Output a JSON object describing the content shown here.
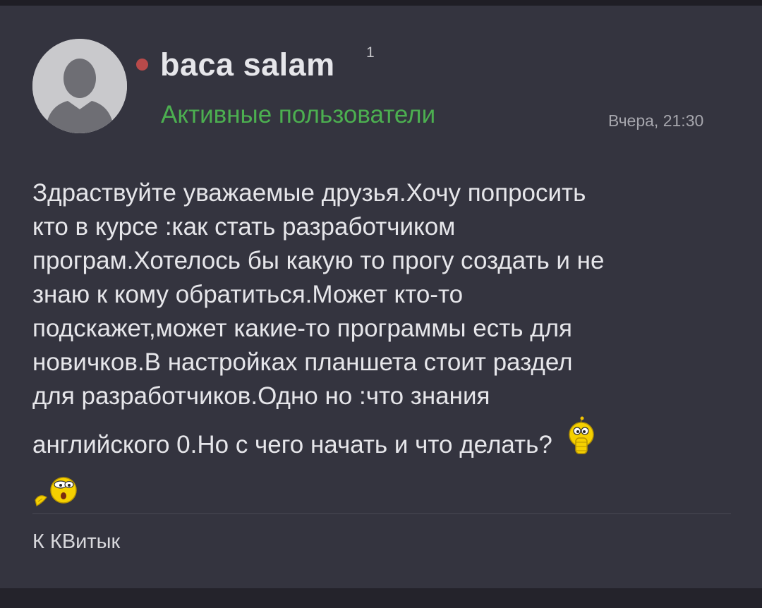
{
  "post": {
    "author": {
      "name": "baca salam",
      "badge_count": "1",
      "group": "Активные пользователи",
      "status_color": "#b84a4a",
      "avatar_icon": "default-user-silhouette-icon"
    },
    "timestamp": "Вчера, 21:30",
    "body_lines": [
      "Здраствуйте уважаемые друзья.Хочу попросить",
      "кто в курсе :как стать разработчиком",
      "програм.Хотелось бы какую то прогу создать и не",
      "знаю к кому обратиться.Может кто-то",
      "подскажет,может какие-то программы есть для",
      "новичков.В настройках планшета стоит раздел",
      "для разработчиков.Одно но :что знания",
      "английского 0.Но с чего начать и что делать?"
    ],
    "emoticons": [
      "thinking-smiley-icon",
      "shocked-smiley-icon"
    ],
    "signature": "К КВитык"
  },
  "colors": {
    "card_background": "#34343f",
    "group_text": "#4caf50",
    "primary_text": "#e6e6ea"
  }
}
